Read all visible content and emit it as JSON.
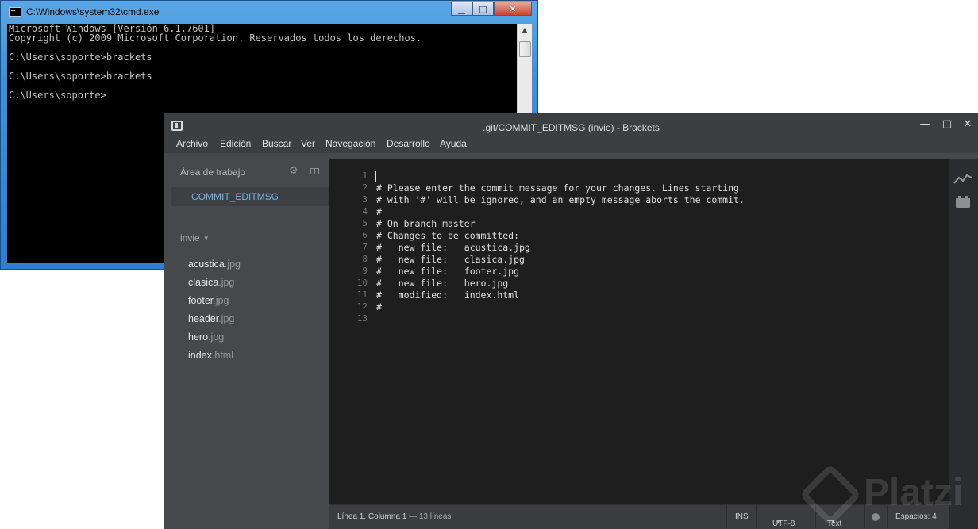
{
  "cmd": {
    "title": "C:\\Windows\\system32\\cmd.exe",
    "controls": {
      "minimize": "▁",
      "maximize": "□",
      "close": "✕"
    },
    "lines": [
      "Microsoft Windows [Versión 6.1.7601]",
      "Copyright (c) 2009 Microsoft Corporation. Reservados todos los derechos.",
      "",
      "C:\\Users\\soporte>brackets",
      "",
      "C:\\Users\\soporte>brackets",
      "",
      "C:\\Users\\soporte>"
    ]
  },
  "brackets": {
    "title": ".git/COMMIT_EDITMSG (invie) - Brackets",
    "window_controls": {
      "minimize": "—",
      "maximize": "□",
      "close": "✕"
    },
    "menu": [
      "Archivo",
      "Edición",
      "Buscar",
      "Ver",
      "Navegación",
      "Desarrollo",
      "Ayuda"
    ],
    "sidebar": {
      "working_set_title": "Área de trabajo",
      "open_file": "COMMIT_EDITMSG",
      "project_name": "invie",
      "files": [
        {
          "name": "acustica",
          "ext": ".jpg"
        },
        {
          "name": "clasica",
          "ext": ".jpg"
        },
        {
          "name": "footer",
          "ext": ".jpg"
        },
        {
          "name": "header",
          "ext": ".jpg"
        },
        {
          "name": "hero",
          "ext": ".jpg"
        },
        {
          "name": "index",
          "ext": ".html"
        }
      ]
    },
    "editor": {
      "line_numbers": [
        "1",
        "2",
        "3",
        "4",
        "5",
        "6",
        "7",
        "8",
        "9",
        "10",
        "11",
        "12",
        "13"
      ],
      "lines": [
        "",
        "# Please enter the commit message for your changes. Lines starting",
        "# with '#' will be ignored, and an empty message aborts the commit.",
        "#",
        "# On branch master",
        "# Changes to be committed:",
        "#   new file:   acustica.jpg",
        "#   new file:   clasica.jpg",
        "#   new file:   footer.jpg",
        "#   new file:   hero.jpg",
        "#   modified:   index.html",
        "#",
        ""
      ]
    },
    "status": {
      "position": "Línea 1, Columna 1",
      "lines": " — 13 líneas",
      "mode": "INS",
      "encoding": "UTF-8",
      "language": "Text",
      "spaces": "Espacios: 4"
    }
  },
  "watermark": "Platzi",
  "colors": {
    "cmd_console_bg": "#000000",
    "cmd_text": "#c0c0c0",
    "editor_bg": "#1e1e1e",
    "sidebar_bg": "#47484b",
    "selected_file": "#6fb6e8"
  }
}
